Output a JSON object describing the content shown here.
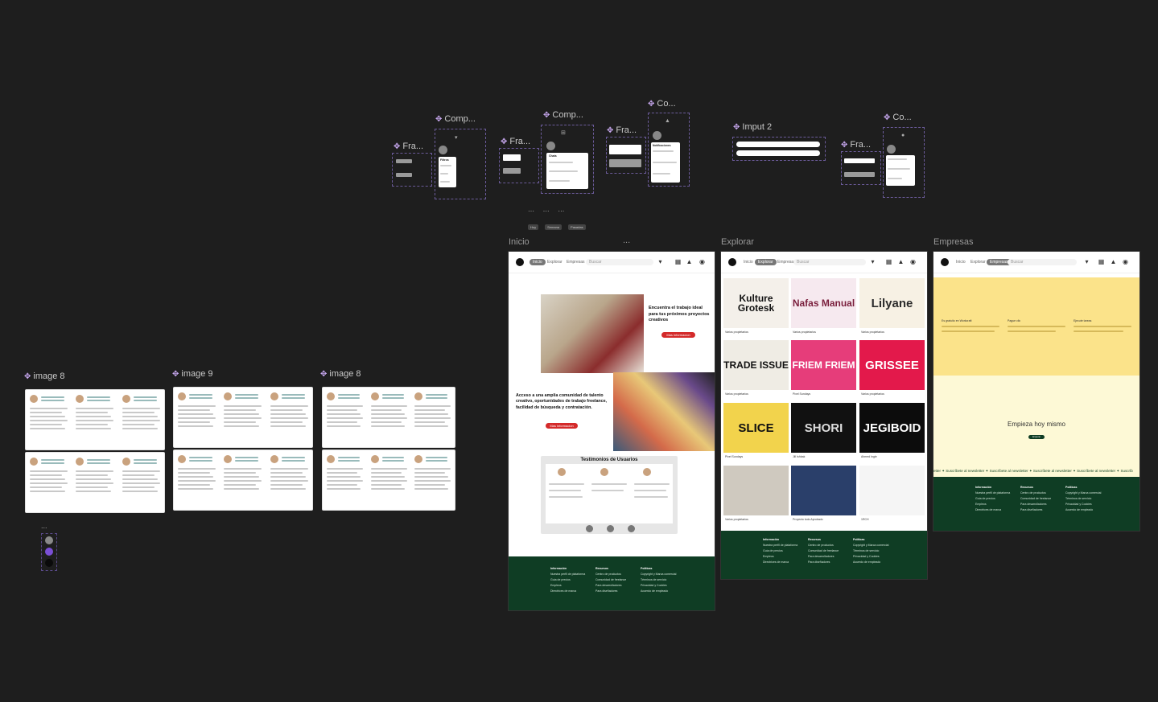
{
  "canvas": {
    "background": "#1e1e1e",
    "accent": "#c8a8f0"
  },
  "labels": {
    "image8_a": "image 8",
    "image9": "image 9",
    "image8_b": "image 8",
    "frame1": "Fra...",
    "comp1": "Comp...",
    "frame2": "Fra...",
    "comp2": "Comp...",
    "frame3": "Fra...",
    "co1": "Co...",
    "imput2": "Imput 2",
    "frame4": "Fra...",
    "co2": "Co...",
    "inicio": "Inicio",
    "dots": "...",
    "explorar": "Explorar",
    "empresas": "Empresas"
  },
  "components": {
    "filtros_title": "Filtros",
    "chats_title": "Chats",
    "notificaciones_title": "Notificaciones",
    "mini_tags": [
      "Hoy",
      "Semana",
      "Pasadas"
    ]
  },
  "inicio": {
    "nav": [
      "Inicio",
      "Explorar",
      "Empresas"
    ],
    "search_placeholder": "Buscar",
    "hero_title": "Encuentra el trabajo ideal para tus próximos proyectos creativos",
    "hero_btn": "Mas informacion",
    "access_title": "Acceso a una amplia comunidad de talento creativo, oportunidades de trabajo freelance, facilidad de búsqueda y contratación.",
    "access_btn": "Mas informacion",
    "testimonials_title": "Testimonios de Usuarios",
    "footer": [
      {
        "h": "Información",
        "items": [
          "Nuestra perfil de plataforma",
          "Guía de precios",
          "Empleos",
          "Directrices de marca"
        ]
      },
      {
        "h": "Recursos",
        "items": [
          "Centro de productos",
          "Comunidad de freelance",
          "Para desarrolladores",
          "Para diseñadores"
        ]
      },
      {
        "h": "Políticas",
        "items": [
          "Copyright y Marca comercial",
          "Términos de servicio",
          "Privacidad y Cookies",
          "Acuerdo de empleado"
        ]
      }
    ]
  },
  "explorar": {
    "nav": [
      "Inicio",
      "Explorar",
      "Empresas"
    ],
    "search_placeholder": "Buscar",
    "tiles": [
      {
        "text": "Kulture Grotesk",
        "bg": "#f4f0ea",
        "fg": "#111",
        "meta": "Varios propietarios"
      },
      {
        "text": "Nafas Manual",
        "bg": "#f6e9ef",
        "fg": "#7a1f3d",
        "meta": "Varios propietarios"
      },
      {
        "text": "Lilyane",
        "bg": "#f7f1e4",
        "fg": "#2b2b2b",
        "meta": "Varios propietarios"
      },
      {
        "text": "TRADE ISSUE",
        "bg": "#efece4",
        "fg": "#111",
        "meta": "Varios propietarios"
      },
      {
        "text": "FRIEM FRIEM",
        "bg": "#e63d7a",
        "fg": "#fff",
        "meta": "Pixel Sundays"
      },
      {
        "text": "GRISSEE",
        "bg": "#e3194b",
        "fg": "#fff",
        "meta": "Varios propietarios"
      },
      {
        "text": "SLICE",
        "bg": "#f2d34c",
        "fg": "#111",
        "meta": "Pixel Sundays"
      },
      {
        "text": "SHORI",
        "bg": "#111",
        "fg": "#ddd",
        "meta": "Jill Ishbak"
      },
      {
        "text": "JEGIBOID",
        "bg": "#0c0c0c",
        "fg": "#fff",
        "meta": "Ahmed Ingle"
      },
      {
        "text": "",
        "bg": "#cfc9bf",
        "fg": "#111",
        "meta": "Varios propietarios"
      },
      {
        "text": "",
        "bg": "#2a3f6a",
        "fg": "#fff",
        "meta": "Proyecto todo Aprobado"
      },
      {
        "text": "",
        "bg": "#f5f5f5",
        "fg": "#111",
        "meta": "1RCH"
      }
    ],
    "footer": [
      {
        "h": "Información",
        "items": [
          "Nuestra perfil de plataforma",
          "Guía de precios",
          "Empleos",
          "Directrices de marca"
        ]
      },
      {
        "h": "Recursos",
        "items": [
          "Centro de productos",
          "Comunidad de freelance",
          "Para desarrolladores",
          "Para diseñadores"
        ]
      },
      {
        "h": "Políticas",
        "items": [
          "Copyright y Marca comercial",
          "Términos de servicio",
          "Privacidad y Cookies",
          "Acuerdo de empleado"
        ]
      }
    ]
  },
  "empresas": {
    "nav": [
      "Inicio",
      "Explorar",
      "Empresas"
    ],
    "search_placeholder": "Buscar",
    "yellow": "#fbe38a",
    "cream": "#fdf9d6",
    "cols": [
      "Es gratuito en Workcraft",
      "Pague clic",
      "Ejecute tareas"
    ],
    "cta_title": "Empieza hoy mismo",
    "cta_btn": "Empezar",
    "marquee": "etter ✦ Suscríbete al newsletter ✦ Suscríbete al newsletter ✦ Suscríbete al newsletter ✦ Suscríbete al newsletter ✦ Suscríb",
    "footer": [
      {
        "h": "Información",
        "items": [
          "Nuestra perfil de plataforma",
          "Guía de precios",
          "Empleos",
          "Directrices de marca"
        ]
      },
      {
        "h": "Recursos",
        "items": [
          "Centro de productos",
          "Comunidad de freelance",
          "Para desarrolladores",
          "Para diseñadores"
        ]
      },
      {
        "h": "Políticas",
        "items": [
          "Copyright y Marca comercial",
          "Términos de servicio",
          "Privacidad y Cookies",
          "Acuerdo de empleado"
        ]
      }
    ]
  },
  "palette": [
    "#8a8a8a",
    "#7b4fd6",
    "#0a0a0a"
  ]
}
